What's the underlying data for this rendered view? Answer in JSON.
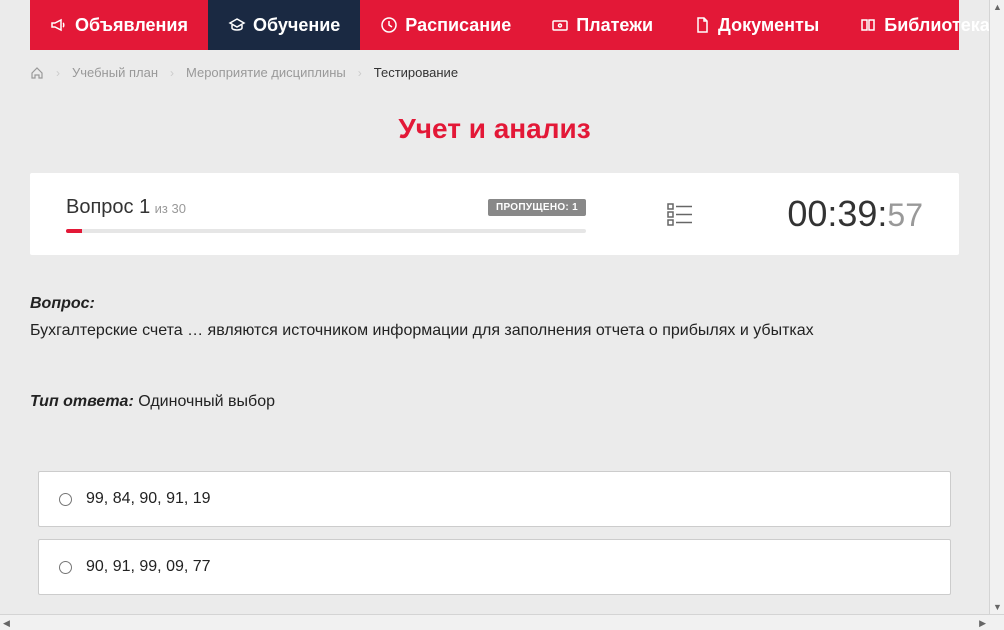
{
  "nav": {
    "items": [
      {
        "label": "Объявления",
        "icon": "megaphone-icon"
      },
      {
        "label": "Обучение",
        "icon": "graduation-icon",
        "active": true
      },
      {
        "label": "Расписание",
        "icon": "clock-icon"
      },
      {
        "label": "Платежи",
        "icon": "payment-icon"
      },
      {
        "label": "Документы",
        "icon": "document-icon"
      },
      {
        "label": "Библиотека",
        "icon": "library-icon",
        "dropdown": true
      }
    ]
  },
  "breadcrumb": {
    "items": [
      "Учебный план",
      "Мероприятие дисциплины",
      "Тестирование"
    ]
  },
  "page_title": "Учет и анализ",
  "progress": {
    "question_label": "Вопрос 1",
    "total_label": "из 30",
    "skipped_label": "ПРОПУЩЕНО: 1",
    "current": 1,
    "total": 30,
    "skipped": 1
  },
  "timer": {
    "main": "00:39:",
    "seconds": "57"
  },
  "question": {
    "label": "Вопрос:",
    "text": "Бухгалтерские счета … являются источником информации для заполнения отчета о прибылях и убытках",
    "answer_type_label": "Тип ответа:",
    "answer_type": "Одиночный выбор"
  },
  "answers": [
    {
      "text": "99, 84, 90, 91, 19"
    },
    {
      "text": "90, 91, 99, 09, 77"
    }
  ]
}
